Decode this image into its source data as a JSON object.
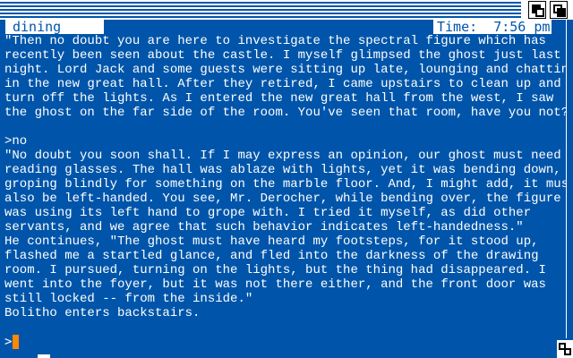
{
  "status": {
    "room": "dining room",
    "time": "Time:  7:56 pm"
  },
  "story_lines": [
    "\"Then no doubt you are here to investigate the spectral figure which has",
    "recently been seen about the castle. I myself glimpsed the ghost just last",
    "night. Lord Jack and some guests were sitting up late, lounging and chatting",
    "in the new great hall. After they retired, I came upstairs to clean up and",
    "turn off the lights. As I entered the new great hall from the west, I saw",
    "the ghost on the far side of the room. You've seen that room, have you not?\"",
    "",
    ">no",
    "\"No doubt you soon shall. If I may express an opinion, our ghost must need",
    "reading glasses. The hall was ablaze with lights, yet it was bending down,",
    "groping blindly for something on the marble floor. And, I might add, it must",
    "also be left-handed. You see, Mr. Derocher, while bending over, the figure",
    "was using its left hand to grope with. I tried it myself, as did other",
    "servants, and we agree that such behavior indicates left-handedness.\"",
    "He continues, \"The ghost must have heard my footsteps, for it stood up,",
    "flashed me a startled glance, and fled into the darkness of the drawing",
    "room. I pursued, turning on the lights, but the thing had disappeared. I",
    "went into the foyer, but it was not there either, and the front door was",
    "still locked -- from the inside.\"",
    "Bolitho enters backstairs."
  ],
  "prompt": {
    "symbol": ">",
    "value": ""
  },
  "colors": {
    "background": "#0055aa",
    "text": "#ffffff",
    "cursor": "#ff8800"
  }
}
